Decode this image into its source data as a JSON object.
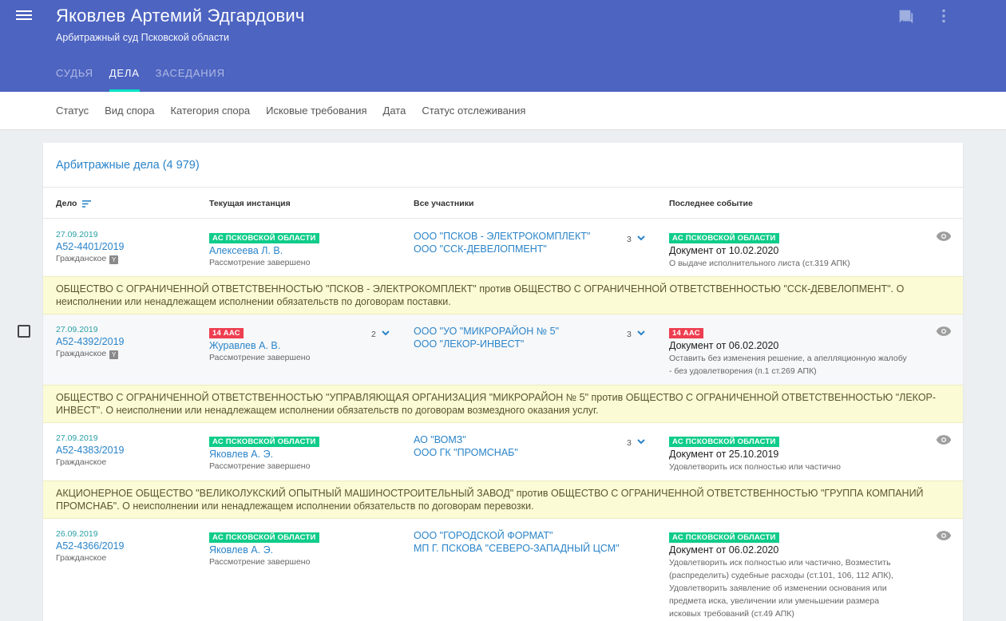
{
  "header": {
    "title": "Яковлев Артемий Эдгардович",
    "subtitle": "Арбитражный суд Псковской области",
    "tabs": [
      {
        "label": "СУДЬЯ"
      },
      {
        "label": "ДЕЛА"
      },
      {
        "label": "ЗАСЕДАНИЯ"
      }
    ]
  },
  "filters": [
    "Статус",
    "Вид спора",
    "Категория спора",
    "Исковые требования",
    "Дата",
    "Статус отслеживания"
  ],
  "card": {
    "title": "Арбитражные дела (4 979)",
    "columns": {
      "case": "Дело",
      "instance": "Текущая инстанция",
      "parties": "Все участники",
      "event": "Последнее событие"
    }
  },
  "rows": [
    {
      "date": "27.09.2019",
      "case_number": "А52-4401/2019",
      "case_type": "Гражданское",
      "badge_icon": "Y",
      "court": "АС ПСКОВСКОЙ ОБЛАСТИ",
      "judge": "Алексеева Л. В.",
      "state": "Рассмотрение завершено",
      "party1": "ООО \"ПСКОВ - ЭЛЕКТРОКОМПЛЕКТ\"",
      "party2": "ООО \"ССК-ДЕВЕЛОПМЕНТ\"",
      "party_count": "3",
      "event_court": "АС ПСКОВСКОЙ ОБЛАСТИ",
      "event_doc": "Документ от 10.02.2020",
      "event_note": "О выдаче исполнительного листа (ст.319 АПК)",
      "description": "ОБЩЕСТВО С ОГРАНИЧЕННОЙ ОТВЕТСТВЕННОСТЬЮ \"ПСКОВ - ЭЛЕКТРОКОМПЛЕКТ\" против ОБЩЕСТВО С ОГРАНИЧЕННОЙ ОТВЕТСТВЕННОСТЬЮ \"ССК-ДЕВЕЛОПМЕНТ\". О неисполнении или ненадлежащем исполнении обязательств по договорам поставки."
    },
    {
      "date": "27.09.2019",
      "case_number": "А52-4392/2019",
      "case_type": "Гражданское",
      "badge_icon": "Y",
      "court": "14 ААС",
      "instance_count": "2",
      "judge": "Журавлев А. В.",
      "state": "Рассмотрение завершено",
      "party1": "ООО \"УО \"МИКРОРАЙОН № 5\"",
      "party2": "ООО \"ЛЕКОР-ИНВЕСТ\"",
      "party_count": "3",
      "event_court": "14 ААС",
      "event_doc": "Документ от 06.02.2020",
      "event_note": "Оставить без изменения решение, а апелляционную жалобу - без удовлетворения (п.1 ст.269 АПК)",
      "description": "ОБЩЕСТВО С ОГРАНИЧЕННОЙ ОТВЕТСТВЕННОСТЬЮ \"УПРАВЛЯЮЩАЯ ОРГАНИЗАЦИЯ \"МИКРОРАЙОН № 5\" против ОБЩЕСТВО С ОГРАНИЧЕННОЙ ОТВЕТСТВЕННОСТЬЮ \"ЛЕКОР-ИНВЕСТ\". О неисполнении или ненадлежащем исполнении обязательств по договорам возмездного оказания услуг."
    },
    {
      "date": "27.09.2019",
      "case_number": "А52-4383/2019",
      "case_type": "Гражданское",
      "court": "АС ПСКОВСКОЙ ОБЛАСТИ",
      "judge": "Яковлев А. Э.",
      "state": "Рассмотрение завершено",
      "party1": "АО \"ВОМЗ\"",
      "party2": "ООО ГК \"ПРОМСНАБ\"",
      "party_count": "3",
      "event_court": "АС ПСКОВСКОЙ ОБЛАСТИ",
      "event_doc": "Документ от 25.10.2019",
      "event_note": "Удовлетворить иск полностью или частично",
      "description": "АКЦИОНЕРНОЕ ОБЩЕСТВО \"ВЕЛИКОЛУКСКИЙ ОПЫТНЫЙ МАШИНОСТРОИТЕЛЬНЫЙ ЗАВОД\" против ОБЩЕСТВО С ОГРАНИЧЕННОЙ ОТВЕТСТВЕННОСТЬЮ \"ГРУППА КОМПАНИЙ ПРОМСНАБ\". О неисполнении или ненадлежащем исполнении обязательств по договорам перевозки."
    },
    {
      "date": "26.09.2019",
      "case_number": "А52-4366/2019",
      "case_type": "Гражданское",
      "court": "АС ПСКОВСКОЙ ОБЛАСТИ",
      "judge": "Яковлев А. Э.",
      "state": "Рассмотрение завершено",
      "party1": "ООО \"ГОРОДСКОЙ ФОРМАТ\"",
      "party2": "МП Г. ПСКОВА \"СЕВЕРО-ЗАПАДНЫЙ ЦСМ\"",
      "event_court": "АС ПСКОВСКОЙ ОБЛАСТИ",
      "event_doc": "Документ от 06.02.2020",
      "event_note": "Удовлетворить иск полностью или частично, Возместить (распределить) судебные расходы (ст.101, 106, 112 АПК), Удовлетворить заявление об изменении основания или предмета иска, увеличении или уменьшении размера исковых требований (ст.49 АПК)"
    }
  ]
}
